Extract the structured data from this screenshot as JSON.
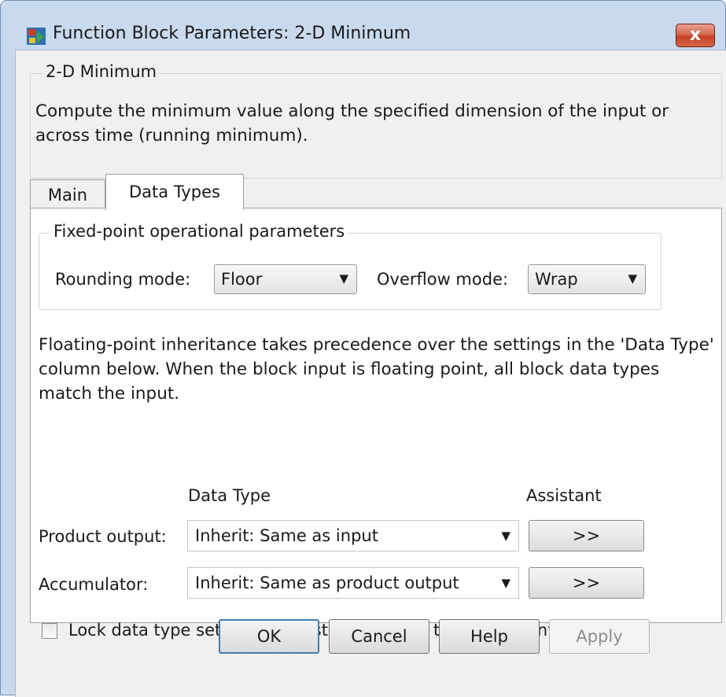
{
  "window": {
    "title": "Function Block Parameters: 2-D Minimum",
    "close_label": "x"
  },
  "description": {
    "group_title": "2-D Minimum",
    "text": "Compute the minimum value along the specified dimension of the input or across time (running minimum)."
  },
  "tabs": [
    {
      "label": "Main",
      "selected": false
    },
    {
      "label": "Data Types",
      "selected": true
    }
  ],
  "fixed_point": {
    "group_title": "Fixed-point operational parameters",
    "rounding_label": "Rounding mode:",
    "rounding_value": "Floor",
    "overflow_label": "Overflow mode:",
    "overflow_value": "Wrap"
  },
  "inheritance_note": "Floating-point inheritance takes precedence over the settings in the 'Data Type' column below. When the block input is floating point, all block data types match the input.",
  "data_types": {
    "column_data_type": "Data Type",
    "column_assistant": "Assistant",
    "rows": [
      {
        "label": "Product output:",
        "value": "Inherit: Same as input",
        "assistant_label": ">>"
      },
      {
        "label": "Accumulator:",
        "value": "Inherit: Same as product output",
        "assistant_label": ">>"
      }
    ]
  },
  "lock": {
    "label": "Lock data type settings against changes by the fixed-point tools",
    "checked": false
  },
  "footer": {
    "ok": "OK",
    "cancel": "Cancel",
    "help": "Help",
    "apply": "Apply"
  },
  "colors": {
    "frame": "#c9daee",
    "close_button": "#c24125",
    "default_button_border": "#3c7fb1"
  }
}
